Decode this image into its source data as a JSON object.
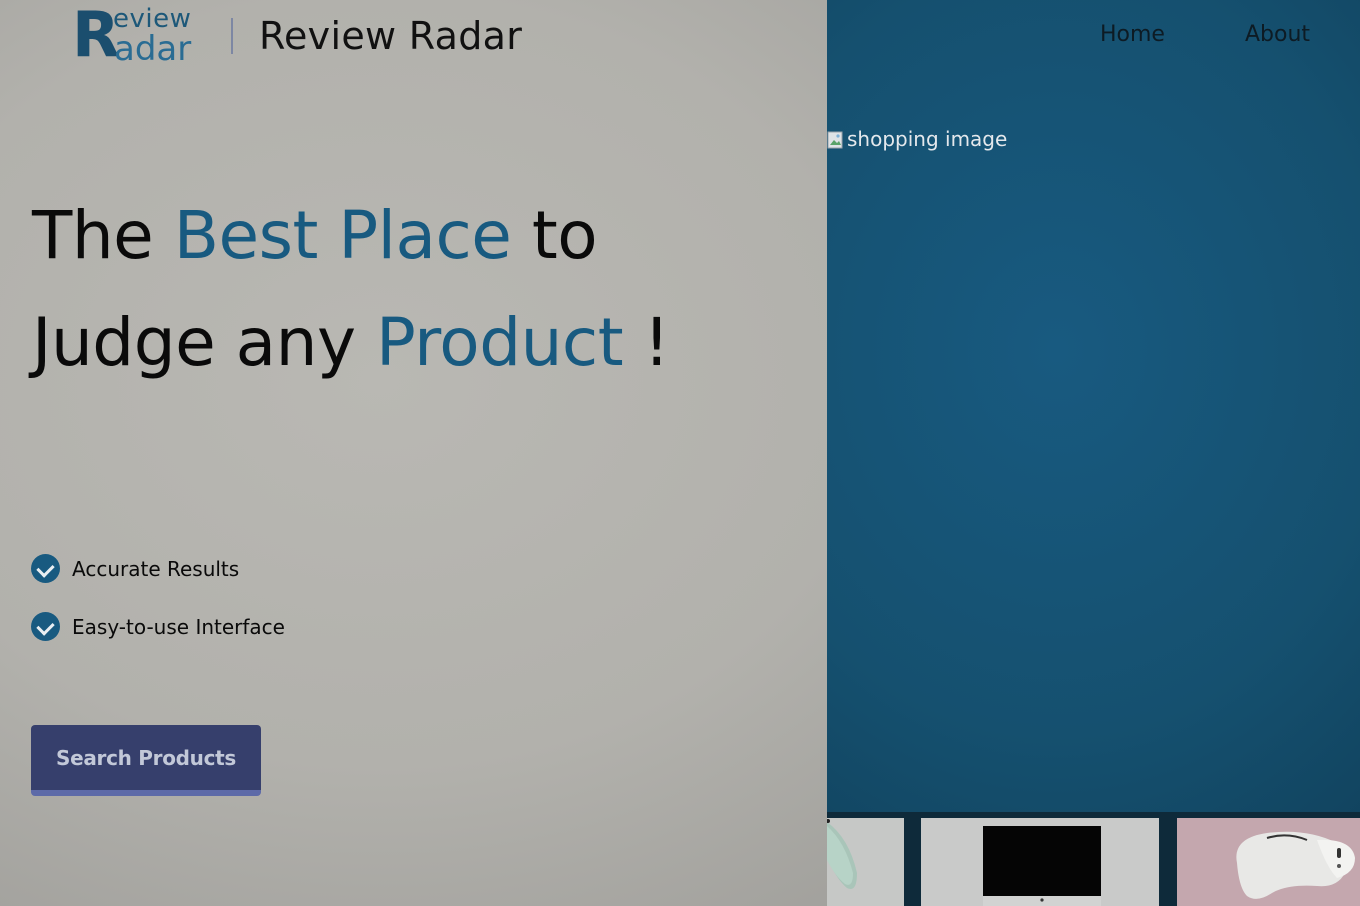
{
  "header": {
    "logo": {
      "initial": "R",
      "top_text": "eview",
      "bottom_text": "adar"
    },
    "brand_title": "Review Radar",
    "nav": [
      {
        "label": "Home"
      },
      {
        "label": "About"
      }
    ]
  },
  "hero": {
    "headline": {
      "part1": "The ",
      "accent1": "Best Place",
      "part2": " to Judge any ",
      "accent2": "Product",
      "part3": " !"
    },
    "features": [
      {
        "label": "Accurate Results"
      },
      {
        "label": "Easy-to-use Interface"
      }
    ],
    "cta_label": "Search Products",
    "image_alt": "shopping image"
  },
  "colors": {
    "accent": "#185a80",
    "right_panel": "#15506f",
    "button": "#363f6c",
    "button_border": "#5d6aa8",
    "left_panel": "#b3b2ad"
  },
  "icons": {
    "feature_icon": "check-circle-icon",
    "broken_image_icon": "broken-image-icon"
  }
}
